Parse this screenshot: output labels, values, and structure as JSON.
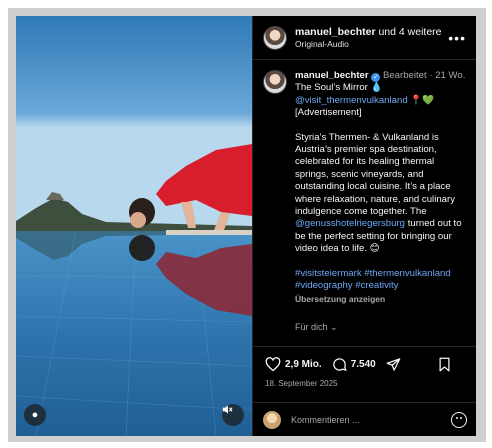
{
  "header": {
    "username": "manuel_bechter",
    "collab_suffix": "und 4 weitere",
    "audio": "Original-Audio",
    "more_icon": "more-horizontal-icon"
  },
  "caption": {
    "username": "manuel_bechter",
    "edited": "Bearbeitet",
    "time": "21 Wo.",
    "title": "The Soul’s Mirror 💧",
    "tag_account": "@visit_thermenvulkanland",
    "tag_emojis": "📍💚",
    "advert": "[Advertisement]",
    "body1": "Styria’s Thermen- & Vulkanland is Austria’s premier spa destination, celebrated for its healing thermal springs, scenic vineyards, and outstanding local cuisine. It’s a place where relaxation, nature, and culinary indulgence come together. The",
    "mention": "@genusshotelriegersburg",
    "body2": "turned out to be the perfect setting for bringing our video idea to life. 😊",
    "hashtags": "#visitsteiermark #thermenvulkanland #videography #creativity",
    "translate": "Übersetzung anzeigen",
    "for_you": "Für dich"
  },
  "actions": {
    "likes": "2,9 Mio.",
    "comments": "7.540",
    "date": "18. September 2025"
  },
  "comment_box": {
    "placeholder": "Kommentieren ..."
  },
  "colors": {
    "background": "#000000",
    "text": "#f5f5f5",
    "muted": "#a8a8a8",
    "link": "#6da8f5",
    "verified": "#3897f0",
    "dress": "#d81e2c"
  }
}
